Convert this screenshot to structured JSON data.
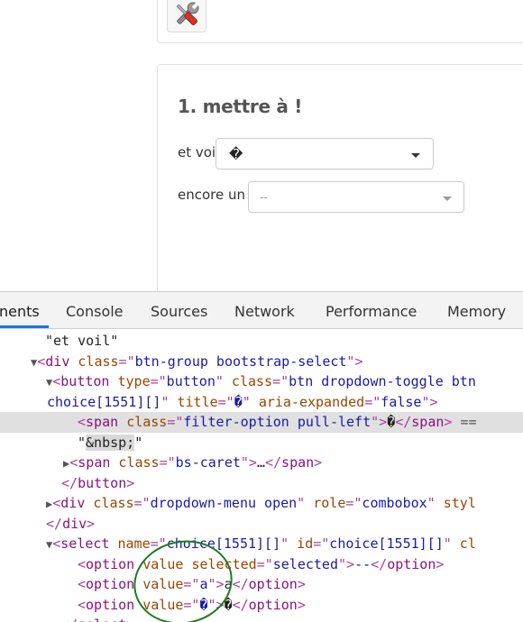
{
  "page": {
    "tool_icon": "tools-icon",
    "question_title": "1. mettre à !",
    "row1": {
      "label": "et voil",
      "selected": "�"
    },
    "row2": {
      "label": "encore un",
      "selected": "--"
    }
  },
  "devtools": {
    "tabs": [
      "nents",
      "Console",
      "Sources",
      "Network",
      "Performance",
      "Memory"
    ],
    "active_tab": "nents",
    "lines": {
      "l1": "\"et voil\"",
      "l2_tag": "div",
      "l2_attr": "class",
      "l2_val": "btn-group bootstrap-select",
      "l3_tag": "button",
      "l3_a1": "type",
      "l3_v1": "button",
      "l3_a2": "class",
      "l3_v2": "btn dropdown-toggle btn",
      "l4_v": "choice[1551][]",
      "l4_a1": "title",
      "l4_v1": "�",
      "l4_a2": "aria-expanded",
      "l4_v2": "false",
      "l5_tag": "span",
      "l5_attr": "class",
      "l5_val": "filter-option pull-left",
      "l5_text": "�",
      "l5_close": "span",
      "l5_suffix": "==",
      "l6_text": "&nbsp;",
      "l7_tag": "span",
      "l7_attr": "class",
      "l7_val": "bs-caret",
      "l7_ell": "…",
      "l7_close": "span",
      "l8_close": "button",
      "l9_tag": "div",
      "l9_a1": "class",
      "l9_v1": "dropdown-menu open",
      "l9_a2": "role",
      "l9_v2": "combobox",
      "l9_a3": "styl",
      "l10_close": "div",
      "l11_tag": "select",
      "l11_a1": "name",
      "l11_v1": "choice[1551][]",
      "l11_a2": "id",
      "l11_v2": "choice[1551][]",
      "l11_a3": "cl",
      "l12_tag": "option",
      "l12_a1": "value",
      "l12_a2": "selected",
      "l12_v2": "selected",
      "l12_text": "--",
      "l12_close": "option",
      "l13_tag": "option",
      "l13_a1": "value",
      "l13_v1": "a",
      "l13_text": "a",
      "l13_close": "option",
      "l14_tag": "option",
      "l14_a1": "value",
      "l14_v1": "�",
      "l14_text": "�",
      "l14_close": "option",
      "l15_close": "select"
    }
  },
  "colors": {
    "tag": "#881280",
    "attr": "#994500",
    "value": "#1a1aa6",
    "annotation": "#1f7a24",
    "tab_underline": "#1a73e8"
  }
}
